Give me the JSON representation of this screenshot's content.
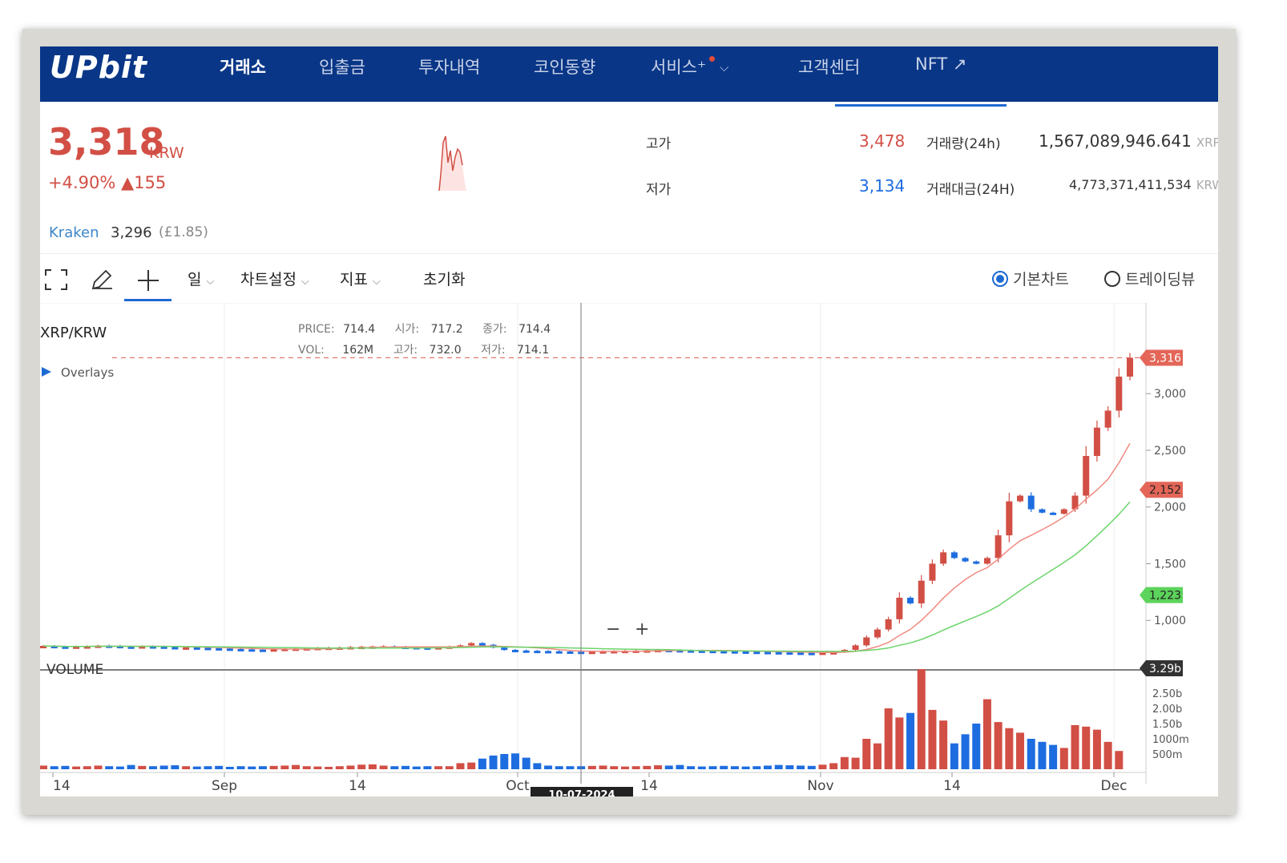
{
  "header": {
    "logo": "UPbit",
    "nav": [
      {
        "label": "거래소",
        "active": true
      },
      {
        "label": "입출금"
      },
      {
        "label": "투자내역"
      },
      {
        "label": "코인동향"
      },
      {
        "label": "서비스⁺"
      },
      {
        "label": "고객센터"
      },
      {
        "label": "NFT ↗"
      }
    ]
  },
  "ticker": {
    "price": "3,318",
    "unit": "KRW",
    "change": "+4.90% ▲155",
    "kraken": {
      "name": "Kraken",
      "price": "3,296",
      "gbp": "(£1.85)"
    },
    "stats": {
      "high_label": "고가",
      "high": "3,478",
      "low_label": "저가",
      "low": "3,134",
      "vol_label": "거래량(24h)",
      "vol": "1,567,089,946.641",
      "vol_unit": "XRP",
      "amount_label": "거래대금(24H)",
      "amount": "4,773,371,411,534",
      "amount_unit": "KRW"
    }
  },
  "toolbar": {
    "period": "일",
    "chart_settings": "차트설정",
    "indicators": "지표",
    "reset": "초기화",
    "basic_chart": "기본차트",
    "tradingview": "트레이딩뷰"
  },
  "chart": {
    "symbol": "XRP/KRW",
    "overlays": "Overlays",
    "ohlc": {
      "price_k": "PRICE:",
      "price": "714.4",
      "open_k": "시가:",
      "open": "717.2",
      "close_k": "종가:",
      "close": "714.4",
      "vol_k": "VOL:",
      "vol": "162M",
      "high_k": "고가:",
      "high": "732.0",
      "low_k": "저가:",
      "low": "714.1"
    },
    "volume_label": "VOLUME",
    "crosshair_date": "10-07-2024",
    "zoom_minus": "−",
    "zoom_plus": "+"
  },
  "chart_data": {
    "type": "candlestick",
    "y_ticks": [
      "1,000",
      "1,500",
      "2,000",
      "2,500",
      "3,000"
    ],
    "ylim": [
      620,
      3800
    ],
    "x_ticks": [
      "14",
      "Sep",
      "14",
      "Oct",
      "14",
      "Nov",
      "14",
      "Dec"
    ],
    "markers": {
      "last": "3,316",
      "ma_short": "2,152",
      "ma_long": "1,223",
      "volume_last": "3.29b"
    },
    "volume_ticks": [
      "500m",
      "1000m",
      "1.50b",
      "2.00b",
      "2.50b"
    ],
    "colors": {
      "up": "#d24f45",
      "down": "#1e6de0",
      "ma_short": "#f08a80",
      "ma_long": "#6cd46a"
    },
    "closes": [
      775,
      770,
      765,
      770,
      772,
      778,
      775,
      770,
      768,
      772,
      770,
      765,
      760,
      762,
      758,
      755,
      752,
      748,
      745,
      742,
      740,
      745,
      750,
      752,
      755,
      758,
      760,
      762,
      765,
      768,
      770,
      772,
      768,
      765,
      762,
      760,
      764,
      770,
      780,
      800,
      785,
      760,
      740,
      735,
      732,
      730,
      728,
      726,
      724,
      722,
      724,
      728,
      730,
      732,
      734,
      736,
      740,
      738,
      736,
      734,
      732,
      730,
      728,
      726,
      724,
      722,
      720,
      718,
      716,
      714,
      712,
      716,
      720,
      740,
      780,
      850,
      920,
      1010,
      1200,
      1150,
      1350,
      1500,
      1600,
      1550,
      1520,
      1500,
      1550,
      1750,
      2050,
      2100,
      1980,
      1950,
      1940,
      1980,
      2100,
      2450,
      2700,
      2850,
      3150,
      3316
    ],
    "volumes": [
      0.12,
      0.1,
      0.11,
      0.09,
      0.1,
      0.12,
      0.1,
      0.09,
      0.14,
      0.11,
      0.1,
      0.12,
      0.13,
      0.1,
      0.09,
      0.1,
      0.11,
      0.08,
      0.1,
      0.09,
      0.1,
      0.11,
      0.12,
      0.14,
      0.1,
      0.09,
      0.08,
      0.1,
      0.12,
      0.15,
      0.16,
      0.12,
      0.1,
      0.11,
      0.09,
      0.1,
      0.1,
      0.1,
      0.2,
      0.22,
      0.35,
      0.45,
      0.5,
      0.52,
      0.38,
      0.2,
      0.12,
      0.1,
      0.1,
      0.1,
      0.11,
      0.12,
      0.1,
      0.09,
      0.1,
      0.11,
      0.13,
      0.12,
      0.14,
      0.1,
      0.09,
      0.1,
      0.11,
      0.1,
      0.09,
      0.1,
      0.12,
      0.14,
      0.13,
      0.12,
      0.11,
      0.15,
      0.2,
      0.4,
      0.38,
      1.0,
      0.85,
      2.0,
      1.7,
      1.85,
      3.29,
      1.95,
      1.6,
      0.85,
      1.15,
      1.5,
      2.3,
      1.55,
      1.35,
      1.2,
      1.0,
      0.9,
      0.8,
      0.7,
      1.45,
      1.4,
      1.3,
      0.9,
      0.6
    ]
  }
}
